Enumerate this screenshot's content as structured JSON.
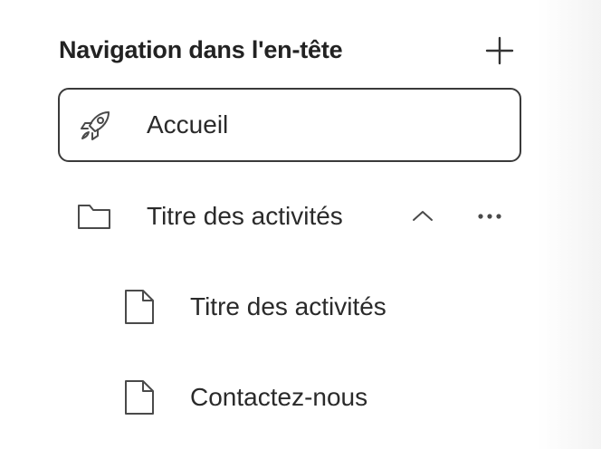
{
  "header": {
    "title": "Navigation dans l'en-tête"
  },
  "nav": {
    "items": [
      {
        "label": "Accueil",
        "icon": "rocket-icon",
        "selected": true
      },
      {
        "label": "Titre des activités",
        "icon": "folder-icon",
        "expanded": true,
        "children": [
          {
            "label": "Titre des activités",
            "icon": "page-icon"
          },
          {
            "label": "Contactez-nous",
            "icon": "page-icon"
          }
        ]
      }
    ]
  },
  "colors": {
    "text": "#2a2a2a",
    "border": "#3a3a3a",
    "icon": "#4a4a4a"
  }
}
